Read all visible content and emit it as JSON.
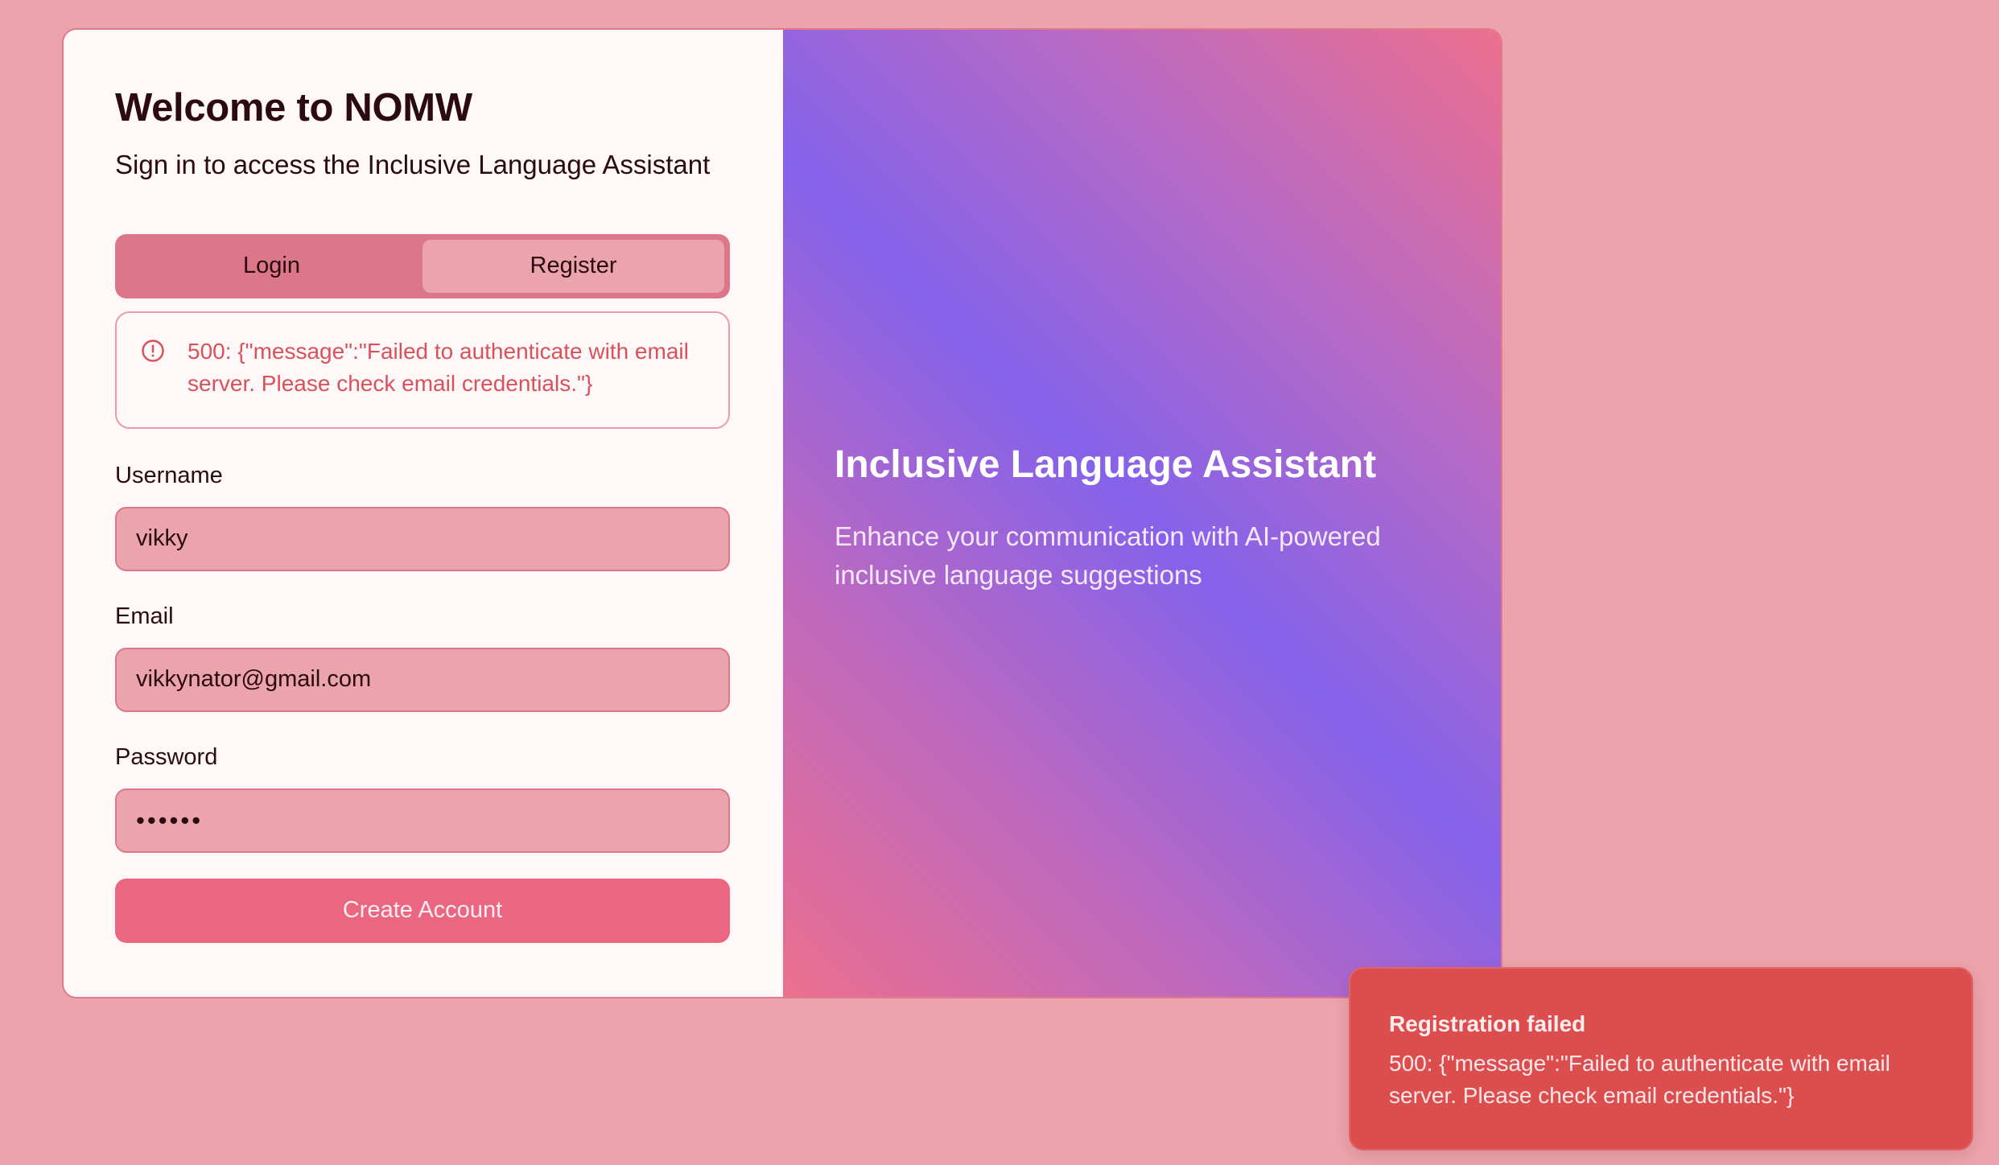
{
  "colors": {
    "page_background": "#eba4ab",
    "panel_background": "#fef8f9",
    "error_red": "#d9525b",
    "primary_button": "#eb6681",
    "toast_background": "#dc4e4d",
    "gradient_purple": "#8562ea",
    "gradient_pink": "#ec6f8e"
  },
  "auth": {
    "title": "Welcome to NOMW",
    "subtitle": "Sign in to access the Inclusive Language Assistant",
    "tabs": [
      {
        "label": "Login",
        "active": false
      },
      {
        "label": "Register",
        "active": true
      }
    ],
    "alert": {
      "icon": "alert-circle-icon",
      "message": "500: {\"message\":\"Failed to authenticate with email server. Please check email credentials.\"}"
    },
    "fields": {
      "username": {
        "label": "Username",
        "value": "vikky"
      },
      "email": {
        "label": "Email",
        "value": "vikkynator@gmail.com"
      },
      "password": {
        "label": "Password",
        "value": "••••••"
      }
    },
    "submit_label": "Create Account"
  },
  "hero": {
    "title": "Inclusive Language Assistant",
    "description": "Enhance your communication with AI-powered inclusive language suggestions"
  },
  "toast": {
    "title": "Registration failed",
    "message": "500: {\"message\":\"Failed to authenticate with email server. Please check email credentials.\"}"
  }
}
